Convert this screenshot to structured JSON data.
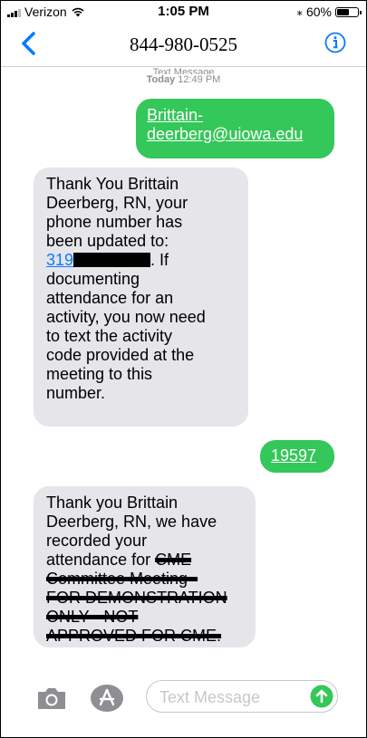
{
  "status_bar": {
    "carrier": "Verizon",
    "time": "1:05 PM",
    "battery": "60%",
    "battery_level": 0.6
  },
  "nav": {
    "contact": "844-980-0525"
  },
  "thread": {
    "header_label": "Text Message",
    "date_bold": "Today",
    "date_time": "12:49 PM"
  },
  "messages": {
    "m1": {
      "line1": "Brittain-",
      "line2": "deerberg@uiowa.edu"
    },
    "m2": {
      "lines_before": [
        "Thank You  Brittain",
        "Deerberg, RN, your",
        "phone number has",
        "been updated to:"
      ],
      "phone_prefix": "319",
      "after_redact": ". If",
      "lines_after": [
        "documenting",
        "attendance for an",
        "activity, you now need",
        "to text the activity",
        "code provided at the",
        "meeting to this",
        "number."
      ]
    },
    "m3": {
      "code": "19597"
    },
    "m4": {
      "lines": [
        "Thank you  Brittain",
        "Deerberg, RN, we have",
        "recorded your"
      ],
      "attendance_prefix": "attendance for ",
      "struck_first": "CME",
      "struck_lines": [
        "Committee Meeting -",
        "FOR DEMONSTRATION",
        "ONLY - NOT",
        "APPROVED FOR CME."
      ]
    }
  },
  "compose": {
    "placeholder": "Text Message"
  },
  "colors": {
    "outgoing": "#34c759",
    "incoming": "#e5e5ea",
    "accent": "#0a7aff"
  },
  "icons": {
    "back": "chevron-left-icon",
    "info": "info-icon",
    "camera": "camera-icon",
    "appstore": "app-store-icon",
    "send": "send-arrow-icon"
  }
}
